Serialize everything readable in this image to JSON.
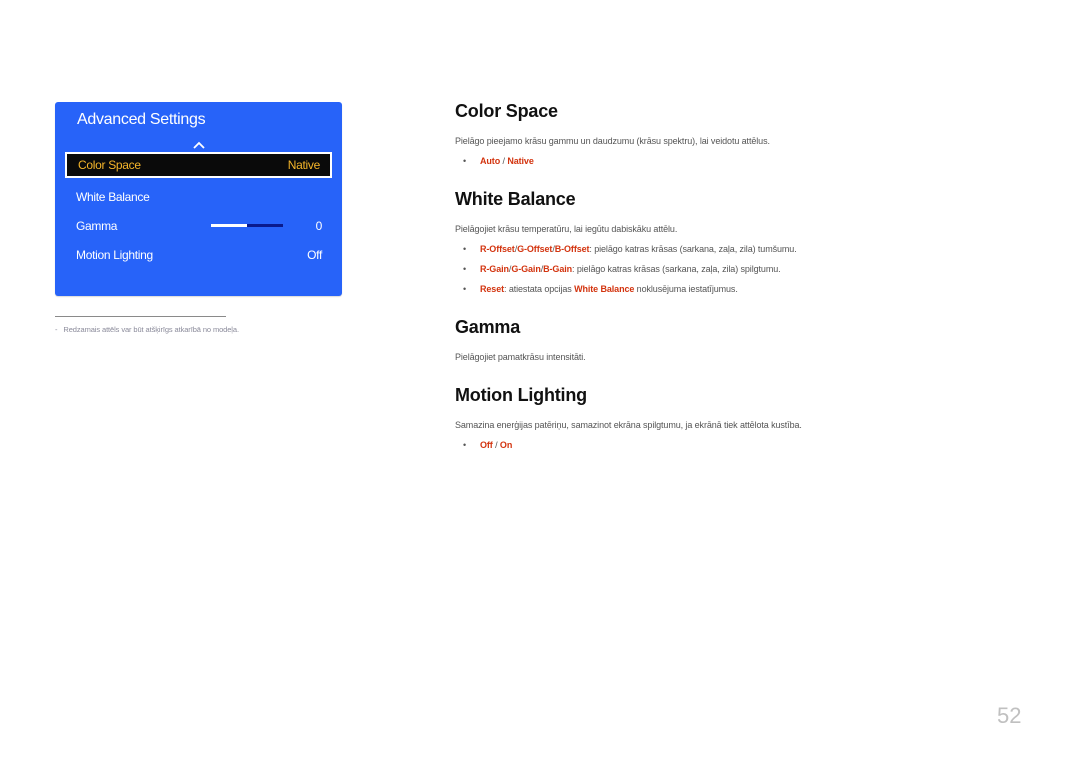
{
  "menu": {
    "title": "Advanced Settings",
    "scroll_up_icon": "chevron-up-icon",
    "items": [
      {
        "label": "Color Space",
        "value": "Native",
        "selected": true
      },
      {
        "label": "White Balance",
        "value": ""
      },
      {
        "label": "Gamma",
        "value": "0",
        "slider_fraction": 0.5
      },
      {
        "label": "Motion Lighting",
        "value": "Off"
      }
    ],
    "colors": {
      "panel": "#2763f9",
      "selected_text": "#f5b52a",
      "selected_bg": "#0a0a0a"
    }
  },
  "footnote": {
    "dash": "-",
    "text": "Redzamais attēls var būt atšķirīgs atkarībā no modeļa."
  },
  "sections": {
    "color_space": {
      "title": "Color Space",
      "desc": "Pielāgo pieejamo krāsu gammu un daudzumu (krāsu spektru), lai veidotu attēlus.",
      "options": [
        "Auto",
        "Native"
      ],
      "sep": "/"
    },
    "white_balance": {
      "title": "White Balance",
      "desc": "Pielāgojiet krāsu temperatūru, lai iegūtu dabiskāku attēlu.",
      "bullets": [
        {
          "keywords": [
            "R-Offset",
            "G-Offset",
            "B-Offset"
          ],
          "text": ": pielāgo katras krāsas (sarkana, zaļa, zila) tumšumu."
        },
        {
          "keywords": [
            "R-Gain",
            "G-Gain",
            "B-Gain"
          ],
          "text": ": pielāgo katras krāsas (sarkana, zaļa, zila) spilgtumu."
        },
        {
          "keyword": "Reset",
          "text1": ": atiestata opcijas ",
          "keyword2": "White Balance",
          "text2": " noklusējuma iestatījumus."
        }
      ]
    },
    "gamma": {
      "title": "Gamma",
      "desc": "Pielāgojiet pamatkrāsu intensitāti."
    },
    "motion_lighting": {
      "title": "Motion Lighting",
      "desc": "Samazina enerģijas patēriņu, samazinot ekrāna spilgtumu, ja ekrānā tiek attēlota kustība.",
      "options": [
        "Off",
        "On"
      ],
      "sep": "/"
    }
  },
  "bullet_char": "•",
  "accent_color": "#d3340f",
  "page_number": "52"
}
